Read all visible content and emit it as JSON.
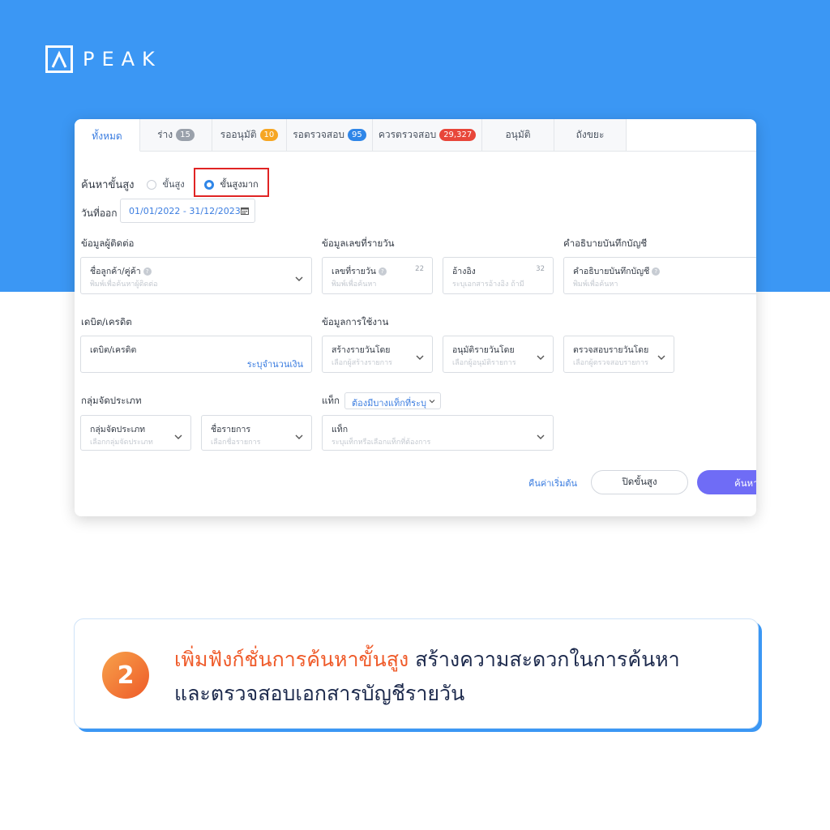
{
  "brand": {
    "logo_text": "PEAK"
  },
  "tabs": [
    {
      "label": "ทั้งหมด",
      "active": true
    },
    {
      "label": "ร่าง",
      "count": "15",
      "badge_color": "#9aa1ab"
    },
    {
      "label": "รออนุมัติ",
      "count": "10",
      "badge_color": "#f6a623"
    },
    {
      "label": "รอตรวจสอบ",
      "count": "95",
      "badge_color": "#2f86e8"
    },
    {
      "label": "ควรตรวจสอบ",
      "count": "29,327",
      "badge_color": "#e8463a"
    },
    {
      "label": "อนุมัติ"
    },
    {
      "label": "ถังขยะ"
    }
  ],
  "search": {
    "title": "ค้นหาขั้นสูง",
    "option_advanced": "ขั้นสูง",
    "option_very_advanced": "ขั้นสูงมาก",
    "selected": "ขั้นสูงมาก"
  },
  "issue_date": {
    "label": "วันที่ออก",
    "value": "01/01/2022 - 31/12/2023"
  },
  "sections": {
    "contact": "ข้อมูลผู้ติดต่อ",
    "journal": "ข้อมูลเลขที่รายวัน",
    "description": "คำอธิบายบันทึกบัญชี",
    "debit_credit": "เดบิต/เครดิต",
    "usage": "ข้อมูลการใช้งาน",
    "category": "กลุ่มจัดประเภท",
    "tag": "แท็ก"
  },
  "fields": {
    "customer": {
      "label": "ชื่อลูกค้า/คู่ค้า",
      "placeholder": "พิมพ์เพื่อค้นหาผู้ติดต่อ"
    },
    "journal_no": {
      "label": "เลขที่รายวัน",
      "count": "22",
      "placeholder": "พิมพ์เพื่อค้นหา"
    },
    "reference": {
      "label": "อ้างอิง",
      "count": "32",
      "placeholder": "ระบุเอกสารอ้างอิง ถ้ามี"
    },
    "description": {
      "label": "คำอธิบายบันทึกบัญชี",
      "placeholder": "พิมพ์เพื่อค้นหา"
    },
    "debit_credit": {
      "label": "เดบิต/เครดิต",
      "action": "ระบุจำนวนเงิน"
    },
    "created_by": {
      "label": "สร้างรายวันโดย",
      "placeholder": "เลือกผู้สร้างรายการ"
    },
    "approved_by": {
      "label": "อนุมัติรายวันโดย",
      "placeholder": "เลือกผู้อนุมัติรายการ"
    },
    "checked_by": {
      "label": "ตรวจสอบรายวันโดย",
      "placeholder": "เลือกผู้ตรวจสอบรายการ"
    },
    "category_group": {
      "label": "กลุ่มจัดประเภท",
      "placeholder": "เลือกกลุ่มจัดประเภท"
    },
    "item_name": {
      "label": "ชื่อรายการ",
      "placeholder": "เลือกชื่อรายการ"
    },
    "tag": {
      "label": "แท็ก",
      "placeholder": "ระบุแท็กหรือเลือกแท็กที่ต้องการ"
    }
  },
  "tag_mode": {
    "value": "ต้องมีบางแท็กที่ระบุ"
  },
  "buttons": {
    "reset": "คืนค่าเริ่มต้น",
    "close_advanced": "ปิดขั้นสูง",
    "search": "ค้นหา"
  },
  "caption": {
    "number": "2",
    "highlight": "เพิ่มฟังก์ชั่นการค้นหาขั้นสูง",
    "rest": " สร้างความสะดวกในการค้นหา",
    "line2": "และตรวจสอบเอกสารบัญชีรายวัน"
  },
  "colors": {
    "brand_blue": "#3b97f4",
    "accent_orange": "#ef5b2a",
    "primary_button": "#6f6cf6",
    "highlight_box": "#e02424"
  }
}
